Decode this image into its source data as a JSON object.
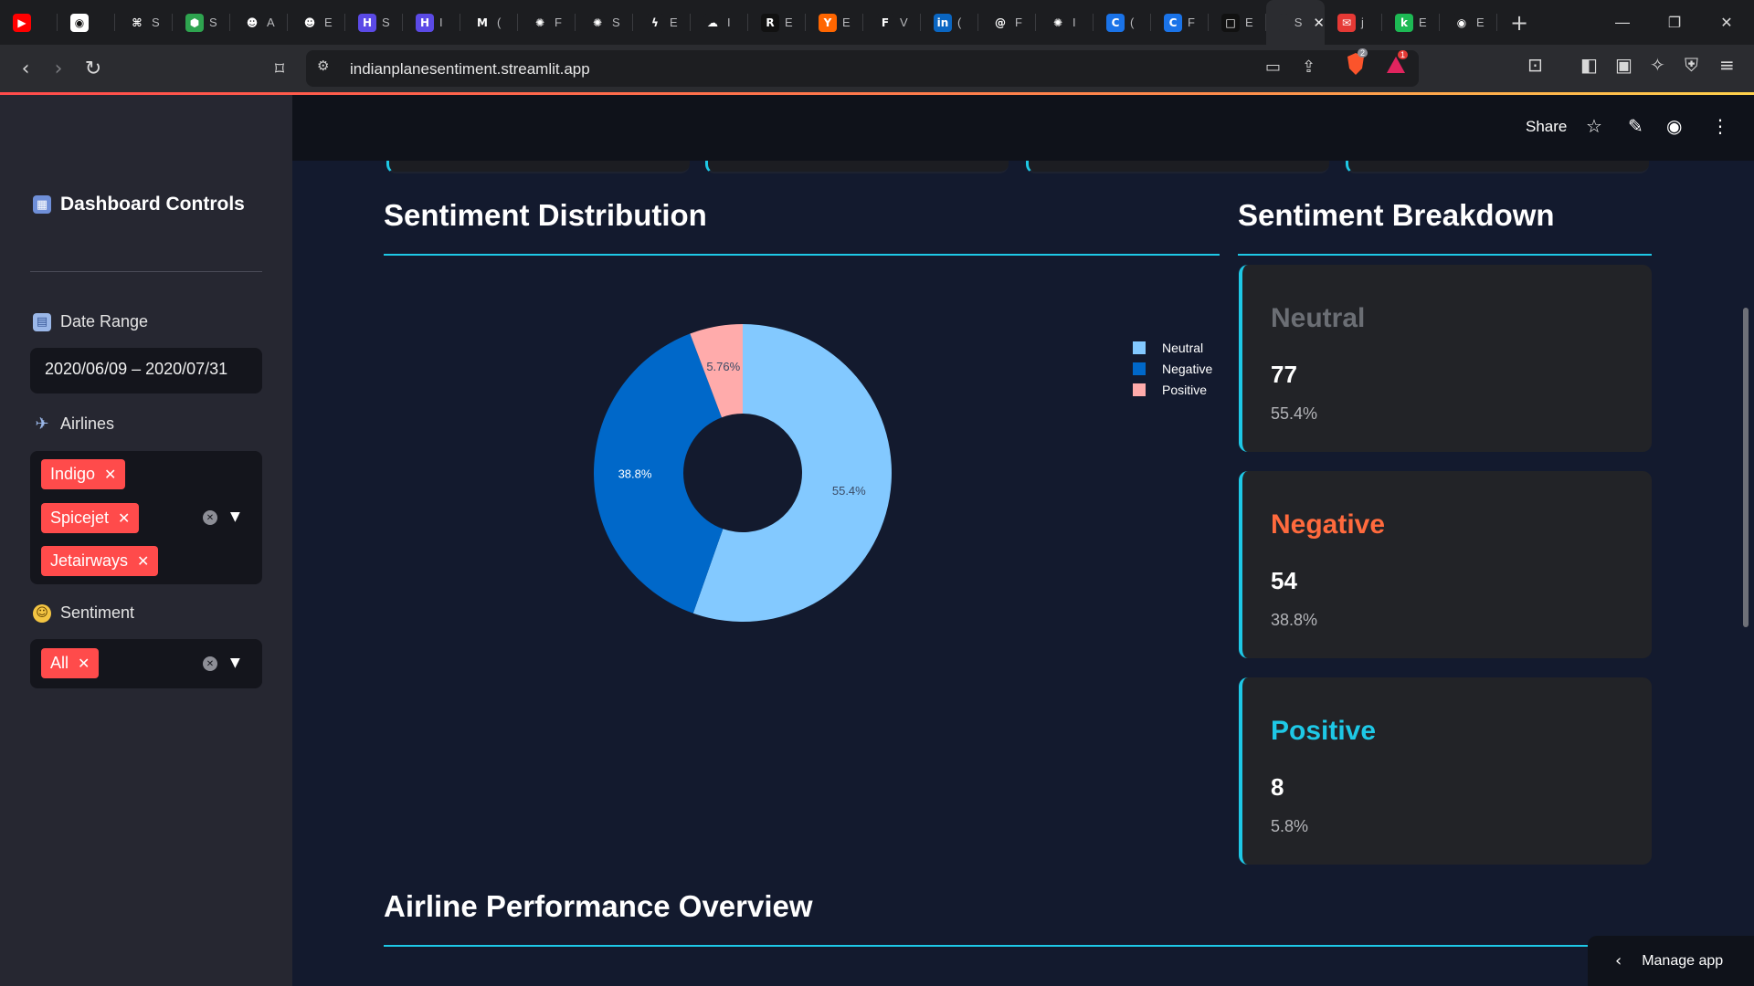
{
  "browser": {
    "tabs": [
      {
        "icon": "youtube-icon",
        "title": "",
        "color": "#ff0000",
        "glyph": "▶"
      },
      {
        "icon": "github-icon",
        "title": "",
        "color": "#ffffff",
        "glyph": "◉"
      },
      {
        "icon": "command-icon",
        "title": "S",
        "color": "#1c1d20",
        "glyph": "⌘"
      },
      {
        "icon": "hexagon-icon",
        "title": "S",
        "color": "#2ea44f",
        "glyph": "⬢"
      },
      {
        "icon": "person-icon",
        "title": "A",
        "color": "#1c1d20",
        "glyph": "☻"
      },
      {
        "icon": "person-icon",
        "title": "E",
        "color": "#1c1d20",
        "glyph": "☻"
      },
      {
        "icon": "hashnode-icon",
        "title": "S",
        "color": "#5b4ae6",
        "glyph": "H"
      },
      {
        "icon": "hashnode-icon",
        "title": "I",
        "color": "#5b4ae6",
        "glyph": "H"
      },
      {
        "icon": "gmail-icon",
        "title": "(",
        "color": "#1c1d20",
        "glyph": "M"
      },
      {
        "icon": "openai-icon",
        "title": "F",
        "color": "#1c1d20",
        "glyph": "✺"
      },
      {
        "icon": "openai-icon",
        "title": "S",
        "color": "#1c1d20",
        "glyph": "✺"
      },
      {
        "icon": "bolt-icon",
        "title": "E",
        "color": "#1c1d20",
        "glyph": "ϟ"
      },
      {
        "icon": "cloud-icon",
        "title": "I",
        "color": "#1c1d20",
        "glyph": "☁"
      },
      {
        "icon": "r-logo-icon",
        "title": "E",
        "color": "#111111",
        "glyph": "R"
      },
      {
        "icon": "ycombinator-icon",
        "title": "E",
        "color": "#ff6600",
        "glyph": "Y"
      },
      {
        "icon": "framer-icon",
        "title": "V",
        "color": "#1c1d20",
        "glyph": "F"
      },
      {
        "icon": "linkedin-icon",
        "title": "(",
        "color": "#0a66c2",
        "glyph": "in"
      },
      {
        "icon": "spiral-icon",
        "title": "F",
        "color": "#1c1d20",
        "glyph": "@"
      },
      {
        "icon": "openai-icon",
        "title": "I",
        "color": "#1c1d20",
        "glyph": "✺"
      },
      {
        "icon": "c-logo-icon",
        "title": "(",
        "color": "#1a73e8",
        "glyph": "C"
      },
      {
        "icon": "c-logo-icon",
        "title": "F",
        "color": "#1a73e8",
        "glyph": "C"
      },
      {
        "icon": "square-icon",
        "title": "E",
        "color": "#111111",
        "glyph": "□"
      },
      {
        "icon": "streamlit-icon",
        "title": "S",
        "color": "#2b2c30",
        "glyph": ""
      },
      {
        "icon": "mail-icon",
        "title": "j",
        "color": "#e53935",
        "glyph": "✉"
      },
      {
        "icon": "k-logo-icon",
        "title": "E",
        "color": "#1db954",
        "glyph": "k"
      },
      {
        "icon": "github-icon",
        "title": "E",
        "color": "#1c1d20",
        "glyph": "◉"
      }
    ],
    "active_tab_index": 22,
    "url": "indianplanesentiment.streamlit.app",
    "brave_count": "2",
    "alert_count": "1"
  },
  "header": {
    "share_label": "Share"
  },
  "sidebar": {
    "title": "Dashboard Controls",
    "date_range": {
      "label": "Date Range",
      "value": "2020/06/09 – 2020/07/31"
    },
    "airlines": {
      "label": "Airlines",
      "selected": [
        "Indigo",
        "Spicejet",
        "Jetairways"
      ]
    },
    "sentiment": {
      "label": "Sentiment",
      "selected": [
        "All"
      ]
    }
  },
  "main": {
    "distribution_title": "Sentiment Distribution",
    "breakdown_title": "Sentiment Breakdown",
    "performance_title": "Airline Performance Overview",
    "cards": [
      {
        "label": "Neutral",
        "count": "77",
        "percent": "55.4%",
        "color": "#6b6e74"
      },
      {
        "label": "Negative",
        "count": "54",
        "percent": "38.8%",
        "color": "#ff6a3d"
      },
      {
        "label": "Positive",
        "count": "8",
        "percent": "5.8%",
        "color": "#1ec8e6"
      }
    ],
    "manage_app_label": "Manage app"
  },
  "chart_data": {
    "type": "pie",
    "hole": true,
    "categories": [
      "Neutral",
      "Negative",
      "Positive"
    ],
    "values": [
      77,
      54,
      8
    ],
    "labels": [
      "55.4%",
      "38.8%",
      "5.76%"
    ],
    "colors": [
      "#83c9ff",
      "#0068c9",
      "#ffabab"
    ],
    "legend": "top-right"
  }
}
